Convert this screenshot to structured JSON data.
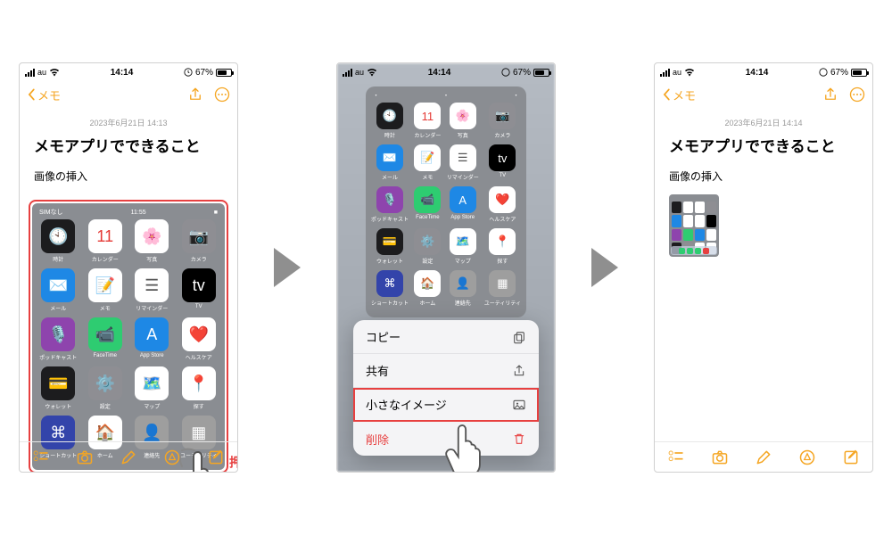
{
  "carrier": "au",
  "screen1": {
    "time": "14:14",
    "battery": "67%",
    "back": "メモ",
    "date": "2023年6月21日 14:13",
    "title": "メモアプリでできること",
    "subtext": "画像の挿入",
    "attachment": {
      "sim": "SIMなし",
      "time": "11:55",
      "apps": [
        {
          "label": "時計",
          "bg": "#1c1c1e",
          "emoji": "🕙"
        },
        {
          "label": "カレンダー",
          "bg": "#ffffff",
          "emoji": "11",
          "txt": "#e53935"
        },
        {
          "label": "写真",
          "bg": "#ffffff",
          "emoji": "🌸"
        },
        {
          "label": "カメラ",
          "bg": "#8e8e93",
          "emoji": "📷"
        },
        {
          "label": "メール",
          "bg": "#1e88e5",
          "emoji": "✉️"
        },
        {
          "label": "メモ",
          "bg": "#ffffff",
          "emoji": "📝"
        },
        {
          "label": "リマインダー",
          "bg": "#ffffff",
          "emoji": "☰",
          "txt": "#555"
        },
        {
          "label": "TV",
          "bg": "#000000",
          "emoji": "tv",
          "txt": "#fff"
        },
        {
          "label": "ポッドキャスト",
          "bg": "#8e44ad",
          "emoji": "🎙️"
        },
        {
          "label": "FaceTime",
          "bg": "#2ecc71",
          "emoji": "📹"
        },
        {
          "label": "App Store",
          "bg": "#1e88e5",
          "emoji": "A",
          "txt": "#fff"
        },
        {
          "label": "ヘルスケア",
          "bg": "#ffffff",
          "emoji": "❤️"
        },
        {
          "label": "ウォレット",
          "bg": "#1c1c1e",
          "emoji": "💳"
        },
        {
          "label": "設定",
          "bg": "#8e8e93",
          "emoji": "⚙️"
        },
        {
          "label": "マップ",
          "bg": "#ffffff",
          "emoji": "🗺️"
        },
        {
          "label": "探す",
          "bg": "#ffffff",
          "emoji": "📍"
        },
        {
          "label": "ショートカット",
          "bg": "#3344aa",
          "emoji": "⌘"
        },
        {
          "label": "ホーム",
          "bg": "#ffffff",
          "emoji": "🏠"
        },
        {
          "label": "連絡先",
          "bg": "#9e9e9e",
          "emoji": "👤"
        },
        {
          "label": "ユーティリティ",
          "bg": "#9e9e9e",
          "emoji": "▦"
        }
      ]
    },
    "long_press_label": "長押",
    "toolbar": [
      "checklist",
      "camera",
      "pen",
      "marker",
      "compose"
    ]
  },
  "screen2": {
    "time": "14:14",
    "battery": "67%",
    "dock_colors": [
      "#2ecc71",
      "#2ecc71",
      "#2ecc71",
      "#e74040"
    ],
    "menu": {
      "copy": "コピー",
      "share": "共有",
      "small_image": "小さなイメージ",
      "delete": "削除"
    }
  },
  "screen3": {
    "time": "14:14",
    "battery": "67%",
    "back": "メモ",
    "date": "2023年6月21日 14:14",
    "title": "メモアプリでできること",
    "subtext": "画像の挿入",
    "thumb_colors": [
      "#1c1c1e",
      "#fff",
      "#fff",
      "#8e8e93",
      "#1e88e5",
      "#fff",
      "#fff",
      "#000",
      "#8e44ad",
      "#2ecc71",
      "#1e88e5",
      "#fff",
      "#1c1c1e",
      "#8e8e93",
      "#fff",
      "#fff"
    ],
    "dock_colors": [
      "#2ecc71",
      "#2ecc71",
      "#2ecc71",
      "#e74040"
    ]
  }
}
